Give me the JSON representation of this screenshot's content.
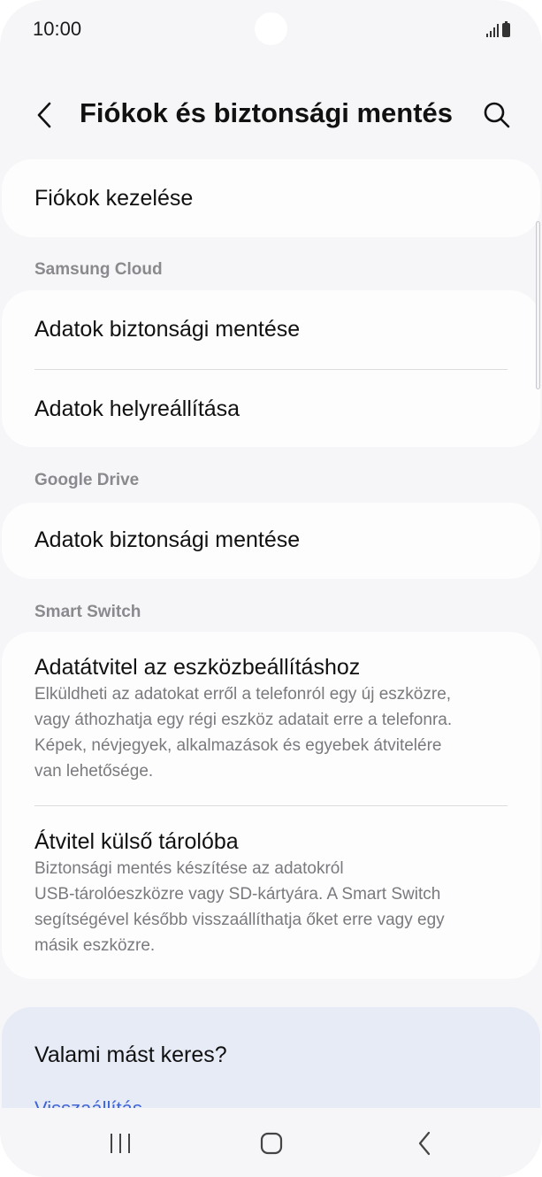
{
  "status_bar": {
    "time": "10:00"
  },
  "header": {
    "title": "Fiókok és biztonsági mentés"
  },
  "accounts": {
    "manage_label": "Fiókok kezelése"
  },
  "samsung_cloud": {
    "header": "Samsung Cloud",
    "items": [
      {
        "label": "Adatok biztonsági mentése"
      },
      {
        "label": "Adatok helyreállítása"
      }
    ]
  },
  "google_drive": {
    "header": "Google Drive",
    "items": [
      {
        "label": "Adatok biztonsági mentése"
      }
    ]
  },
  "smart_switch": {
    "header": "Smart Switch",
    "items": [
      {
        "title": "Adatátvitel az eszközbeállításhoz",
        "desc_lines": [
          "Elküldheti az adatokat erről a telefonról egy új eszközre,",
          "vagy áthozhatja egy régi eszköz adatait erre a telefonra.",
          "Képek, névjegyek, alkalmazások és egyebek átvitelére",
          "van lehetősége."
        ]
      },
      {
        "title": "Átvitel külső tárolóba",
        "desc_lines": [
          "Biztonsági mentés készítése az adatokról",
          "USB-tárolóeszközre vagy SD-kártyára. A Smart Switch",
          "segítségével később visszaállíthatja őket erre vagy egy",
          "másik eszközre."
        ]
      }
    ]
  },
  "suggestions": {
    "title": "Valami mást keres?",
    "link": "Visszaállítás"
  },
  "colors": {
    "background": "#f6f6f8",
    "card": "#fdfdfe",
    "suggest_card": "#e7ebf6",
    "link": "#3e64d6",
    "secondary_text": "#7a7a7e"
  },
  "icons": {
    "back": "chevron-left-icon",
    "search": "search-icon",
    "nav_recents": "recents-icon",
    "nav_home": "home-icon",
    "nav_back": "back-icon"
  }
}
